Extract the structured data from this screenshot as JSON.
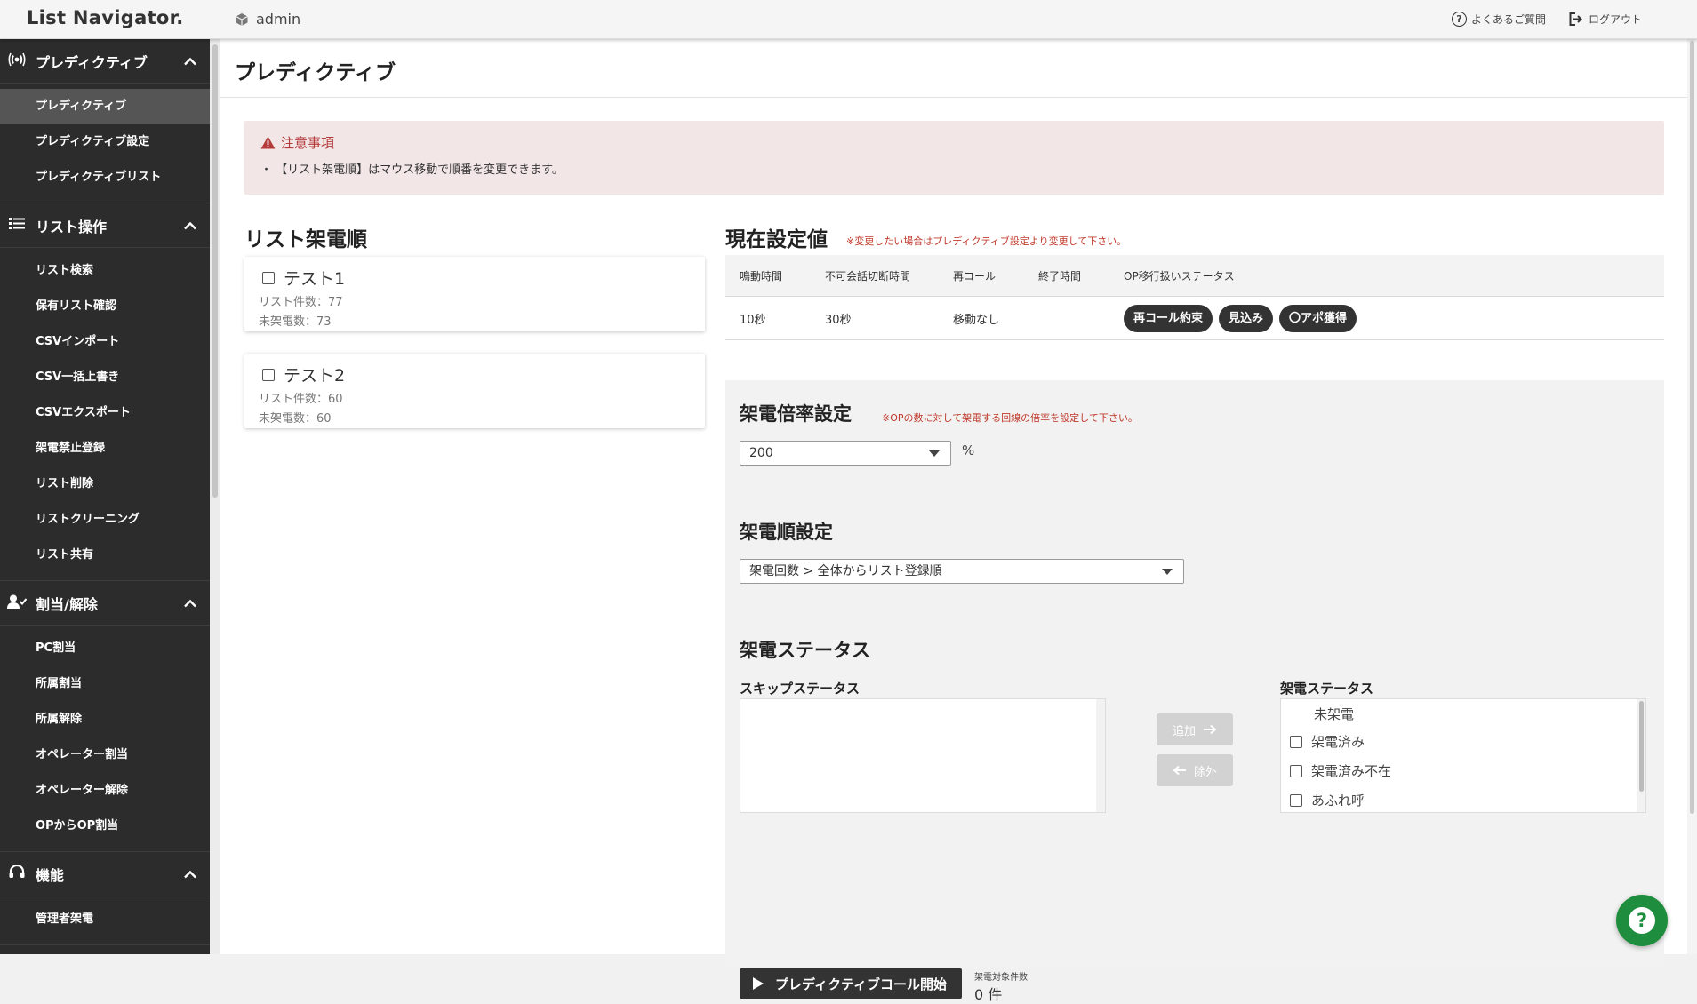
{
  "app": {
    "logo": "List Navigator.",
    "user": "admin",
    "faq": "よくあるご質問",
    "logout": "ログアウト"
  },
  "sidebar": {
    "sections": [
      {
        "title": "プレディクティブ",
        "items": [
          "プレディクティブ",
          "プレディクティブ設定",
          "プレディクティブリスト"
        ]
      },
      {
        "title": "リスト操作",
        "items": [
          "リスト検索",
          "保有リスト確認",
          "CSVインポート",
          "CSV一括上書き",
          "CSVエクスポート",
          "架電禁止登録",
          "リスト削除",
          "リストクリーニング",
          "リスト共有"
        ]
      },
      {
        "title": "割当/解除",
        "items": [
          "PC割当",
          "所属割当",
          "所属解除",
          "オペレーター割当",
          "オペレーター解除",
          "OPからOP割当"
        ]
      },
      {
        "title": "機能",
        "items": [
          "管理者架電"
        ]
      }
    ]
  },
  "page": {
    "title": "プレディクティブ"
  },
  "notice": {
    "title": "注意事項",
    "body": "・ 【リスト架電順】はマウス移動で順番を変更できます。"
  },
  "call_order": {
    "title": "リスト架電順",
    "lists": [
      {
        "name": "テスト1",
        "count": "リスト件数：77",
        "uncalled": "未架電数：73"
      },
      {
        "name": "テスト2",
        "count": "リスト件数：60",
        "uncalled": "未架電数：60"
      }
    ]
  },
  "current": {
    "title": "現在設定値",
    "note": "※変更したい場合はプレディクティブ設定より変更して下さい。",
    "headers": [
      "鳴動時間",
      "不可会話切断時間",
      "再コール",
      "終了時間",
      "OP移行扱いステータス"
    ],
    "row": {
      "ring": "10秒",
      "cut": "30秒",
      "recall": "移動なし",
      "end": "",
      "statuses": [
        "再コール約束",
        "見込み",
        "〇アポ獲得"
      ]
    }
  },
  "ratio": {
    "title": "架電倍率設定",
    "note": "※OPの数に対して架電する回線の倍率を設定して下さい。",
    "value": "200",
    "unit": "%"
  },
  "order": {
    "title": "架電順設定",
    "value": "架電回数 > 全体からリスト登録順"
  },
  "status": {
    "title": "架電ステータス",
    "skip_label": "スキップステータス",
    "call_label": "架電ステータス",
    "add": "追加",
    "remove": "除外",
    "call_items": [
      "未架電",
      "架電済み",
      "架電済み不在",
      "あふれ呼"
    ]
  },
  "start": {
    "label": "プレディクティブコール開始",
    "count_label": "架電対象件数",
    "count": "0 件"
  }
}
